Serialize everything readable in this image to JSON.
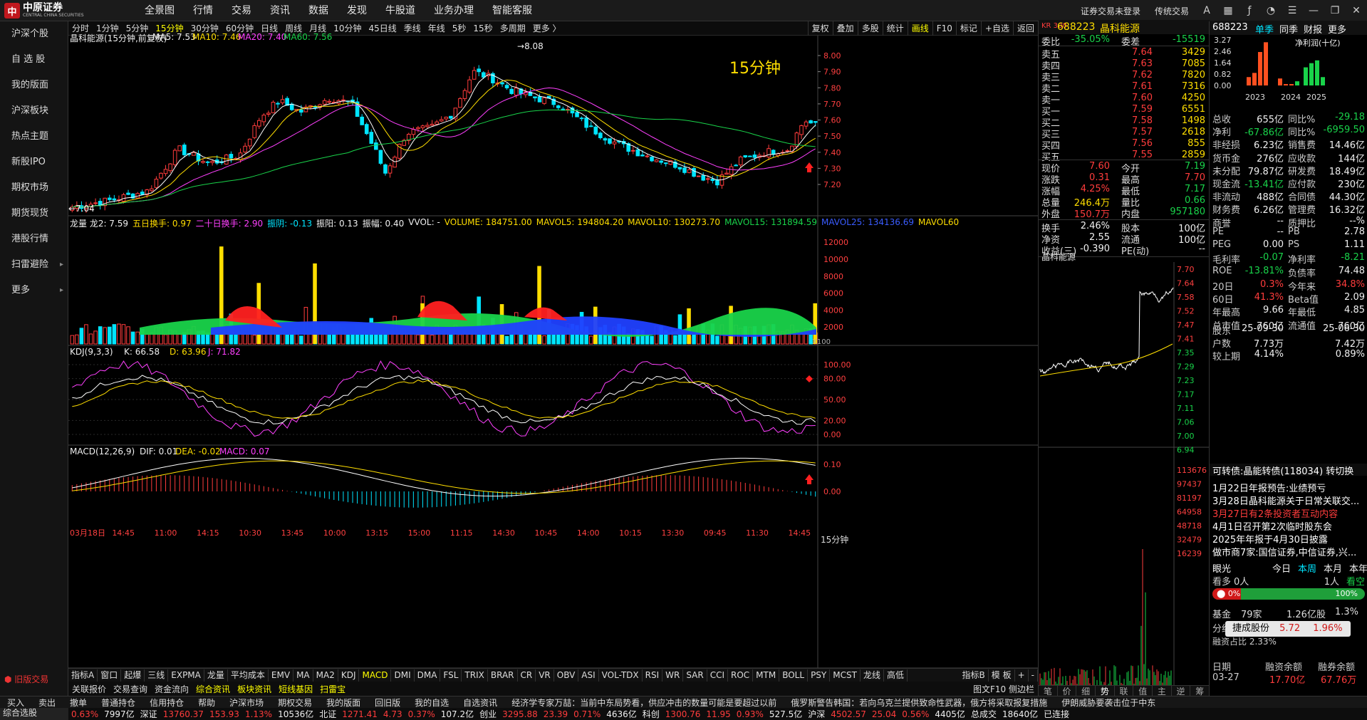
{
  "logo": {
    "cn": "中原证券",
    "en": "CENTRAL CHINA SECURITIES"
  },
  "menu": [
    "全景图",
    "行情",
    "交易",
    "资讯",
    "数据",
    "发现",
    "牛股道",
    "业务办理",
    "智能客服"
  ],
  "topright": {
    "login": "证券交易未登录",
    "style": "传统交易"
  },
  "sidebar": [
    "沪深个股",
    "自 选 股",
    "我的版面",
    "沪深板块",
    "热点主题",
    "新股IPO",
    "期权市场",
    "期货现货",
    "港股行情",
    "扫雷避险",
    "更多"
  ],
  "old_version": "旧版交易",
  "combined_select": "综合选股",
  "periods": [
    "分时",
    "1分钟",
    "5分钟",
    "15分钟",
    "30分钟",
    "60分钟",
    "日线",
    "周线",
    "月线",
    "10分钟",
    "45日线",
    "季线",
    "年线",
    "5秒",
    "15秒",
    "多周期",
    "更多 〉"
  ],
  "active_period": "15分钟",
  "chart_tools": [
    "复权",
    "叠加",
    "多股",
    "统计",
    "画线",
    "F10",
    "标记",
    "+自选",
    "返回"
  ],
  "main_chart": {
    "title": "晶科能源(15分钟,前复权)",
    "ma5": "MA5: 7.53",
    "ma10": "MA10: 7.46",
    "ma20": "MA20: 7.40",
    "ma60": "MA60: 7.56",
    "period_tag": "15分钟",
    "high_mark": "8.08",
    "low_mark": "7.04",
    "y_ticks": [
      "8.00",
      "7.90",
      "7.80",
      "7.70",
      "7.60",
      "7.50",
      "7.40",
      "7.30",
      "7.20"
    ]
  },
  "vol_panel": {
    "items": [
      {
        "t": "龙量 龙2: 7.59",
        "c": "white"
      },
      {
        "t": "五日换手: 0.97",
        "c": "yellow"
      },
      {
        "t": "二十日换手: 2.90",
        "c": "magenta"
      },
      {
        "t": "振阴: -0.13",
        "c": "cyan"
      },
      {
        "t": "振阳: 0.13",
        "c": "white"
      },
      {
        "t": "振幅: 0.40",
        "c": "white"
      },
      {
        "t": "VVOL: -",
        "c": "white"
      },
      {
        "t": "VOLUME: 184751.00",
        "c": "yellow"
      },
      {
        "t": "MAVOL5: 194804.20",
        "c": "yellow"
      },
      {
        "t": "MAVOL10: 130273.70",
        "c": "yellow"
      },
      {
        "t": "MAVOL15: 131894.59",
        "c": "green"
      },
      {
        "t": "MAVOL25: 134136.69",
        "c": "blue"
      },
      {
        "t": "MAVOL60",
        "c": "yellow"
      }
    ],
    "y_ticks": [
      "12000",
      "10000",
      "8000",
      "6000",
      "4000",
      "2000"
    ],
    "unit": "X100"
  },
  "kdj_panel": {
    "title": "KDJ(9,3,3)",
    "k": "K: 66.58",
    "d": "D: 63.96",
    "j": "J: 71.82",
    "y_ticks": [
      "100.00",
      "80.00",
      "50.00",
      "20.00",
      "0.00"
    ]
  },
  "macd_panel": {
    "title": "MACD(12,26,9)",
    "dif": "DIF: 0.01",
    "dea": "DEA: -0.02",
    "macd": "MACD: 0.07",
    "y_ticks": [
      "0.10",
      "0.00"
    ]
  },
  "x_axis": [
    "03月18日",
    "14:45",
    "11:00",
    "14:15",
    "10:30",
    "13:45",
    "10:00",
    "13:15",
    "15:00",
    "11:15",
    "14:30",
    "10:45",
    "14:00",
    "10:15",
    "13:30",
    "09:45",
    "11:30",
    "14:45"
  ],
  "x_axis_right": "15分钟",
  "indicators": [
    "指标A",
    "窗口",
    "起爆",
    "三线",
    "EXPMA",
    "龙量",
    "平均成本",
    "EMV",
    "MA",
    "MA2",
    "KDJ",
    "MACD",
    "DMI",
    "DMA",
    "FSL",
    "TRIX",
    "BRAR",
    "CR",
    "VR",
    "OBV",
    "ASI",
    "VOL-TDX",
    "RSI",
    "WR",
    "SAR",
    "CCI",
    "ROC",
    "MTM",
    "BOLL",
    "PSY",
    "MCST",
    "龙线",
    "高低"
  ],
  "active_indicator": "MACD",
  "indicator_right": [
    "指标B",
    "模 板",
    "+",
    "-"
  ],
  "subtabs": [
    "关联报价",
    "交易查询",
    "资金流向",
    "综合资讯",
    "板块资讯",
    "短线基因",
    "扫雷宝"
  ],
  "subtabs_right": "图文F10 侧边栏",
  "quote": {
    "code": "688223",
    "name": "晶科能源",
    "badge": "KR 300",
    "weibi": "委比",
    "weibi_v": "-35.05%",
    "weicha": "委差",
    "weicha_v": "-15519",
    "sells": [
      [
        "卖五",
        "7.64",
        "3429"
      ],
      [
        "卖四",
        "7.63",
        "7085"
      ],
      [
        "卖三",
        "7.62",
        "7820"
      ],
      [
        "卖二",
        "7.61",
        "7316"
      ],
      [
        "卖一",
        "7.60",
        "4250"
      ]
    ],
    "buys": [
      [
        "买一",
        "7.59",
        "6551"
      ],
      [
        "买二",
        "7.58",
        "1498"
      ],
      [
        "买三",
        "7.57",
        "2618"
      ],
      [
        "买四",
        "7.56",
        "855"
      ],
      [
        "买五",
        "7.55",
        "2859"
      ]
    ],
    "stats": [
      [
        "现价",
        "7.60",
        "red",
        "今开",
        "7.19",
        "green"
      ],
      [
        "涨跌",
        "0.31",
        "red",
        "最高",
        "7.70",
        "red"
      ],
      [
        "涨幅",
        "4.25%",
        "red",
        "最低",
        "7.17",
        "green"
      ],
      [
        "总量",
        "246.4万",
        "yellow",
        "量比",
        "0.66",
        "green"
      ],
      [
        "外盘",
        "150.7万",
        "red",
        "内盘",
        "957180",
        "green"
      ]
    ],
    "stats2": [
      [
        "换手",
        "2.46%",
        "股本",
        "100亿"
      ],
      [
        "净资",
        "2.55",
        "流通",
        "100亿"
      ],
      [
        "收益(三)",
        "-0.390",
        "PE(动)",
        "--"
      ]
    ],
    "mini_title": "晶科能源",
    "mini_y": [
      "7.70",
      "7.64",
      "7.58",
      "7.52",
      "7.47",
      "7.41",
      "7.35",
      "7.29",
      "7.23",
      "7.17",
      "7.11",
      "7.06",
      "7.00",
      "6.94"
    ],
    "vol_y": [
      "113676",
      "97437",
      "81197",
      "64958",
      "48718",
      "32479",
      "16239"
    ],
    "tabs": [
      "笔",
      "价",
      "细",
      "势",
      "联",
      "值",
      "主",
      "逆",
      "筹"
    ]
  },
  "info": {
    "code": "688223",
    "tabs": [
      "单季",
      "同季",
      "财报",
      "更多"
    ],
    "chart_title": "净利润(十亿)",
    "bar_y": [
      "3.27",
      "2.46",
      "1.64",
      "0.82",
      "0.00"
    ],
    "years": [
      "2023",
      "2024",
      "2025"
    ],
    "rows1": [
      [
        "总收",
        "655亿",
        "white",
        "同比%",
        "-29.18",
        "green"
      ],
      [
        "净利",
        "-67.86亿",
        "green",
        "同比%",
        "-6959.50",
        "green"
      ],
      [
        "非经损",
        "6.23亿",
        "white",
        "销售费",
        "14.46亿",
        "white"
      ],
      [
        "货币金",
        "276亿",
        "white",
        "应收款",
        "144亿",
        "white"
      ],
      [
        "未分配",
        "79.87亿",
        "white",
        "研发费",
        "18.49亿",
        "white"
      ],
      [
        "现金流",
        "-13.41亿",
        "green",
        "应付款",
        "230亿",
        "white"
      ],
      [
        "非流动",
        "488亿",
        "white",
        "合同债",
        "44.30亿",
        "white"
      ],
      [
        "财务费",
        "6.26亿",
        "white",
        "管理费",
        "16.32亿",
        "white"
      ],
      [
        "商誉",
        "--",
        "white",
        "质押比",
        "--%",
        "white"
      ]
    ],
    "rows2": [
      [
        "PE",
        "--",
        "white",
        "PB",
        "2.78",
        "white"
      ],
      [
        "PEG",
        "0.00",
        "white",
        "PS",
        "1.11",
        "white"
      ],
      [
        "毛利率",
        "-0.07",
        "green",
        "净利率",
        "-8.21",
        "green"
      ],
      [
        "ROE",
        "-13.81%",
        "green",
        "负债率",
        "74.48",
        "white"
      ]
    ],
    "rows3": [
      [
        "20日",
        "0.3%",
        "red",
        "今年来",
        "34.8%",
        "red"
      ],
      [
        "60日",
        "41.3%",
        "red",
        "Beta值",
        "2.09",
        "white"
      ],
      [
        "年最高",
        "9.66",
        "white",
        "年最低",
        "4.85",
        "white"
      ],
      [
        "总市值",
        "760亿",
        "white",
        "流通值",
        "760亿",
        "white"
      ]
    ],
    "rows4": [
      [
        "股东",
        "25-09-30",
        "white",
        "",
        "25-06-30",
        "white"
      ],
      [
        "户数",
        "7.73万",
        "white",
        "",
        "7.42万",
        "white"
      ],
      [
        "较上期",
        "4.14%",
        "white",
        "",
        "0.89%",
        "white"
      ]
    ],
    "convert": "可转债:晶能转债(118034) 转切换",
    "news": [
      {
        "t": "1月22日年报预告:业绩预亏",
        "c": "white"
      },
      {
        "t": "3月28日晶科能源关于日常关联交...",
        "c": "white"
      },
      {
        "t": "3月27日有2条投资者互动内容",
        "c": "red"
      },
      {
        "t": "4月1日召开第2次临时股东会",
        "c": "white"
      },
      {
        "t": "2025年年报于4月30日披露",
        "c": "white"
      }
    ],
    "market_maker": "做市商7家:国信证券,中信证券,兴...",
    "eye": "眼光",
    "eye_tabs": [
      "今日",
      "本周",
      "本月",
      "本年"
    ],
    "bull": "看多",
    "bull_n": "0人",
    "bear_n": "1人",
    "bear": "看空",
    "bull_pct": "0%",
    "bear_pct": "100%",
    "fund": [
      "基金",
      "79家",
      "1.26亿股",
      "1.3%"
    ],
    "fenhong": "分红",
    "capital": "融资占比 2.33%",
    "popup": {
      "name": "捷成股份",
      "price": "5.72",
      "pct": "1.96%"
    },
    "rz_head": [
      "日期",
      "融资余额",
      "融券余额"
    ],
    "rz_row": [
      "03-27",
      "17.70亿",
      "67.76万"
    ]
  },
  "funcbar": [
    "买入",
    "卖出",
    "撤单",
    "普通持仓",
    "信用持仓",
    "帮助",
    "沪深市场",
    "期权交易",
    "我的版面",
    "回旧版",
    "我的自选",
    "自选资讯"
  ],
  "news_ticker": [
    "经济学专家万喆：当前中东局势看，供应冲击的数量可能是要超过以前",
    "俄罗斯警告韩国：若向乌克兰提供致命性武器，俄方将采取报复措施",
    "伊朗威胁要袭击位于中东"
  ],
  "indices": [
    {
      "t": "0.63%",
      "c": "red"
    },
    {
      "t": "7997亿",
      "c": "white"
    },
    {
      "t": "深证",
      "c": "white"
    },
    {
      "t": "13760.37",
      "c": "red"
    },
    {
      "t": "153.93",
      "c": "red"
    },
    {
      "t": "1.13%",
      "c": "red"
    },
    {
      "t": "10536亿",
      "c": "white"
    },
    {
      "t": "北证",
      "c": "white"
    },
    {
      "t": "1271.41",
      "c": "red"
    },
    {
      "t": "4.73",
      "c": "red"
    },
    {
      "t": "0.37%",
      "c": "red"
    },
    {
      "t": "107.2亿",
      "c": "white"
    },
    {
      "t": "创业",
      "c": "white"
    },
    {
      "t": "3295.88",
      "c": "red"
    },
    {
      "t": "23.39",
      "c": "red"
    },
    {
      "t": "0.71%",
      "c": "red"
    },
    {
      "t": "4636亿",
      "c": "white"
    },
    {
      "t": "科创",
      "c": "white"
    },
    {
      "t": "1300.76",
      "c": "red"
    },
    {
      "t": "11.95",
      "c": "red"
    },
    {
      "t": "0.93%",
      "c": "red"
    },
    {
      "t": "527.5亿",
      "c": "white"
    },
    {
      "t": "沪深",
      "c": "white"
    },
    {
      "t": "4502.57",
      "c": "red"
    },
    {
      "t": "25.04",
      "c": "red"
    },
    {
      "t": "0.56%",
      "c": "red"
    },
    {
      "t": "4405亿",
      "c": "white"
    },
    {
      "t": "总成交",
      "c": "white"
    },
    {
      "t": "18640亿",
      "c": "white"
    },
    {
      "t": "已连接",
      "c": "white"
    }
  ]
}
